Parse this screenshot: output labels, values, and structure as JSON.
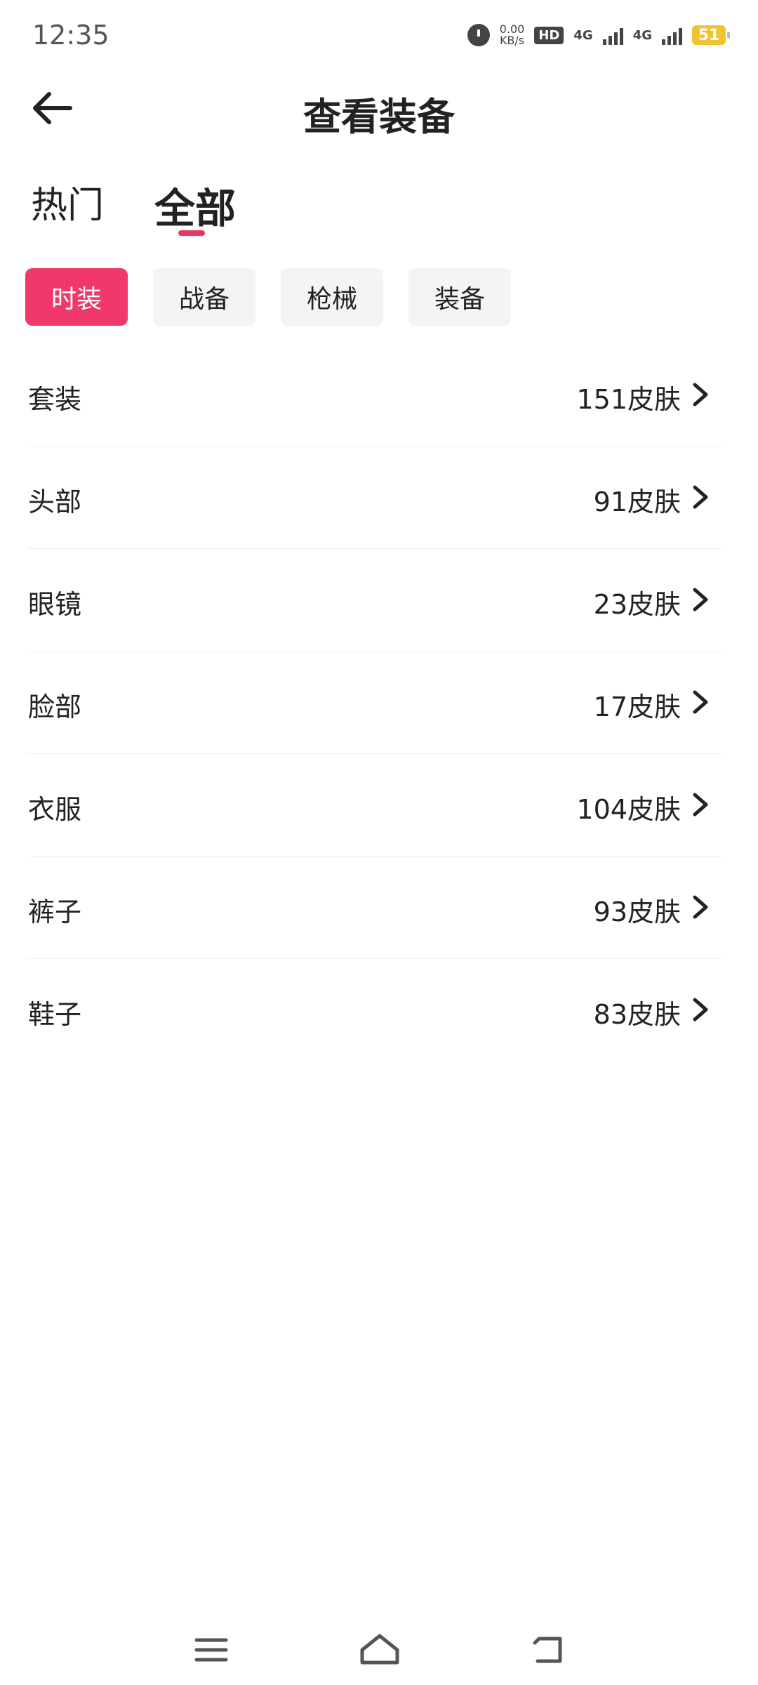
{
  "status": {
    "time": "12:35",
    "speed_value": "0.00",
    "speed_unit": "KB/s",
    "hd_label": "HD",
    "net1": "4G",
    "net2": "4G",
    "battery": "51"
  },
  "header": {
    "title": "查看装备"
  },
  "tabs": [
    {
      "label": "热门"
    },
    {
      "label": "全部"
    }
  ],
  "chips": [
    {
      "label": "时装",
      "active": true
    },
    {
      "label": "战备"
    },
    {
      "label": "枪械"
    },
    {
      "label": "装备"
    }
  ],
  "list": [
    {
      "name": "套装",
      "count": "151皮肤"
    },
    {
      "name": "头部",
      "count": "91皮肤"
    },
    {
      "name": "眼镜",
      "count": "23皮肤"
    },
    {
      "name": "脸部",
      "count": "17皮肤"
    },
    {
      "name": "衣服",
      "count": "104皮肤"
    },
    {
      "name": "裤子",
      "count": "93皮肤"
    },
    {
      "name": "鞋子",
      "count": "83皮肤"
    }
  ],
  "colors": {
    "accent": "#f0386a",
    "chip_bg": "#f2f4f6",
    "battery": "#f1c232"
  },
  "icons": {
    "back": "arrow-left-icon",
    "chevron": "chevron-right-icon",
    "nav_menu": "menu-icon",
    "nav_home": "home-icon",
    "nav_back": "back-icon"
  }
}
